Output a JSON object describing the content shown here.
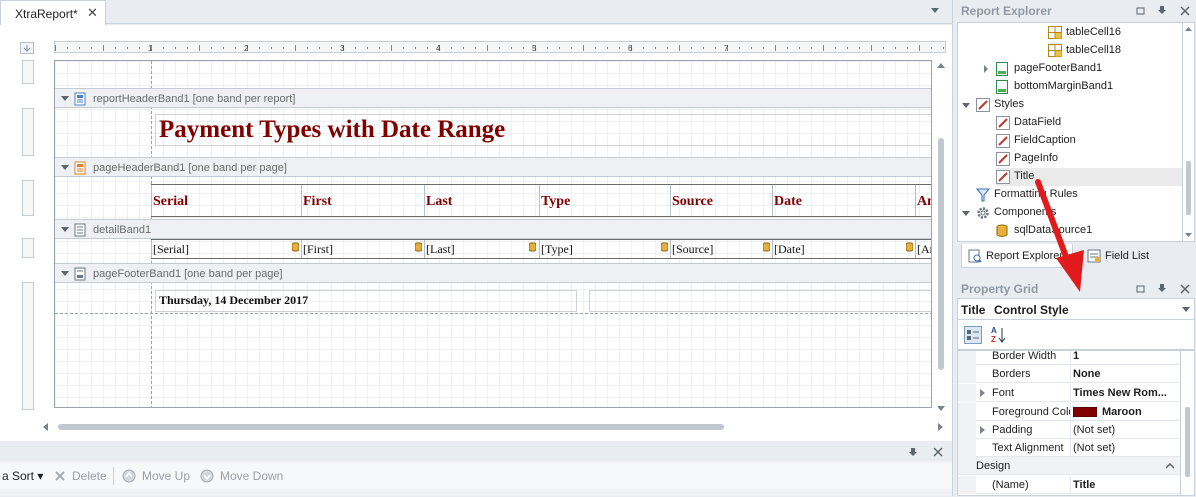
{
  "document_tab": {
    "label": "XtraReport*",
    "close": "✕"
  },
  "ruler": {
    "numbers": [
      "1",
      "2",
      "3",
      "4",
      "5",
      "6",
      "7"
    ]
  },
  "bands": {
    "report_header": "reportHeaderBand1 [one band per report]",
    "page_header": "pageHeaderBand1 [one band per page]",
    "detail": "detailBand1",
    "page_footer": "pageFooterBand1 [one band per page]"
  },
  "report": {
    "title": "Payment Types with Date Range",
    "columns": [
      "Serial",
      "First",
      "Last",
      "Type",
      "Source",
      "Date",
      "Am"
    ],
    "fields": [
      "[Serial]",
      "[First]",
      "[Last]",
      "[Type]",
      "[Source]",
      "[Date]",
      "[Am"
    ],
    "footer_date": "Thursday, 14 December 2017"
  },
  "group_toolbar": {
    "sort_label": "a Sort",
    "delete_label": "Delete",
    "move_up_label": "Move Up",
    "move_down_label": "Move Down"
  },
  "report_explorer": {
    "title": "Report Explorer",
    "items": [
      {
        "label": "tableCell16",
        "icon": "table-cell-icon"
      },
      {
        "label": "tableCell18",
        "icon": "table-cell-icon"
      },
      {
        "label": "pageFooterBand1",
        "icon": "band-icon"
      },
      {
        "label": "bottomMarginBand1",
        "icon": "band-icon"
      },
      {
        "label": "Styles",
        "icon": "style-icon"
      },
      {
        "label": "DataField",
        "icon": "style-icon"
      },
      {
        "label": "FieldCaption",
        "icon": "style-icon"
      },
      {
        "label": "PageInfo",
        "icon": "style-icon"
      },
      {
        "label": "Title",
        "icon": "style-icon"
      },
      {
        "label": "Formatting Rules",
        "icon": "formatting-rules-icon"
      },
      {
        "label": "Components",
        "icon": "gear-icon"
      },
      {
        "label": "sqlDataSource1",
        "icon": "database-icon"
      }
    ],
    "tabs": [
      "Report Explorer",
      "Field List"
    ]
  },
  "property_grid": {
    "title": "Property Grid",
    "selected_object_name": "Title",
    "selected_object_type": "Control Style",
    "rows": [
      {
        "name": "Border Width",
        "value": "1"
      },
      {
        "name": "Borders",
        "value": "None"
      },
      {
        "name": "Font",
        "value": "Times New Rom..."
      },
      {
        "name": "Foreground Colo",
        "value": "Maroon"
      },
      {
        "name": "Padding",
        "value": "(Not set)"
      },
      {
        "name": "Text Alignment",
        "value": "(Not set)"
      }
    ],
    "category": "Design",
    "design_rows": [
      {
        "name": "(Name)",
        "value": "Title"
      }
    ]
  },
  "colors": {
    "title_color": "#800000",
    "accent_arrow": "#e11b1b",
    "panel_bg": "#e9edf2"
  }
}
